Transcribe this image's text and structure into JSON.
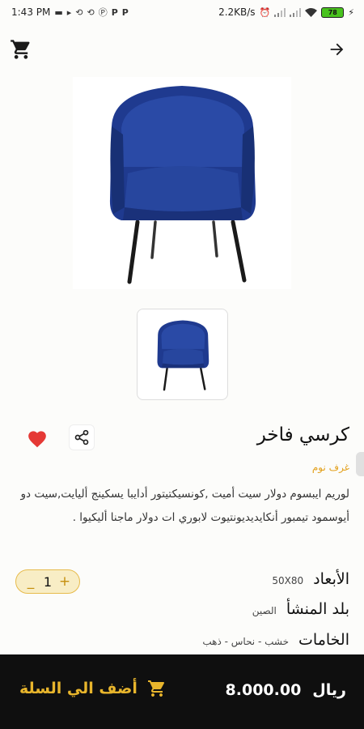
{
  "status_bar": {
    "time": "1:43 PM",
    "network_speed": "2.2KB/s",
    "battery": "78",
    "left_icons": [
      "message-icon",
      "play-icon",
      "sync-icon",
      "sync-icon",
      "parking-icon",
      "p-icon",
      "p-icon"
    ],
    "right_icons": [
      "alarm-icon",
      "signal-icon",
      "signal-icon",
      "wifi-icon",
      "battery-icon"
    ]
  },
  "app_bar": {
    "cart_icon": "shopping-cart-icon",
    "back_icon": "arrow-right-icon"
  },
  "product": {
    "title": "كرسي فاخر",
    "category": "غرف نوم",
    "description": "لوريم ايبسوم دولار سيت أميت ,كونسيكتيتور أدايبا يسكينج أليايت,سيت دو أيوسمود تيمبور أنكايديديونتيوت لابوري ات دولار ماجنا أليكيوا .",
    "favorite": true,
    "quantity": "1"
  },
  "specs": {
    "dimensions_label": "الأبعاد",
    "dimensions_value": "50X80",
    "origin_label": "بلد المنشأ",
    "origin_value": "الصين",
    "materials_label": "الخامات",
    "materials_value": "خشب - نحاس - ذهب"
  },
  "bottom_bar": {
    "add_to_cart": "أضف الي السلة",
    "price": "8.000.00",
    "currency": "ريال"
  },
  "colors": {
    "accent": "#e8b52c",
    "bottom_bar": "#0f0f0f",
    "heart": "#e53935",
    "category": "#e3a11d",
    "chair": "#1f3a8f"
  }
}
